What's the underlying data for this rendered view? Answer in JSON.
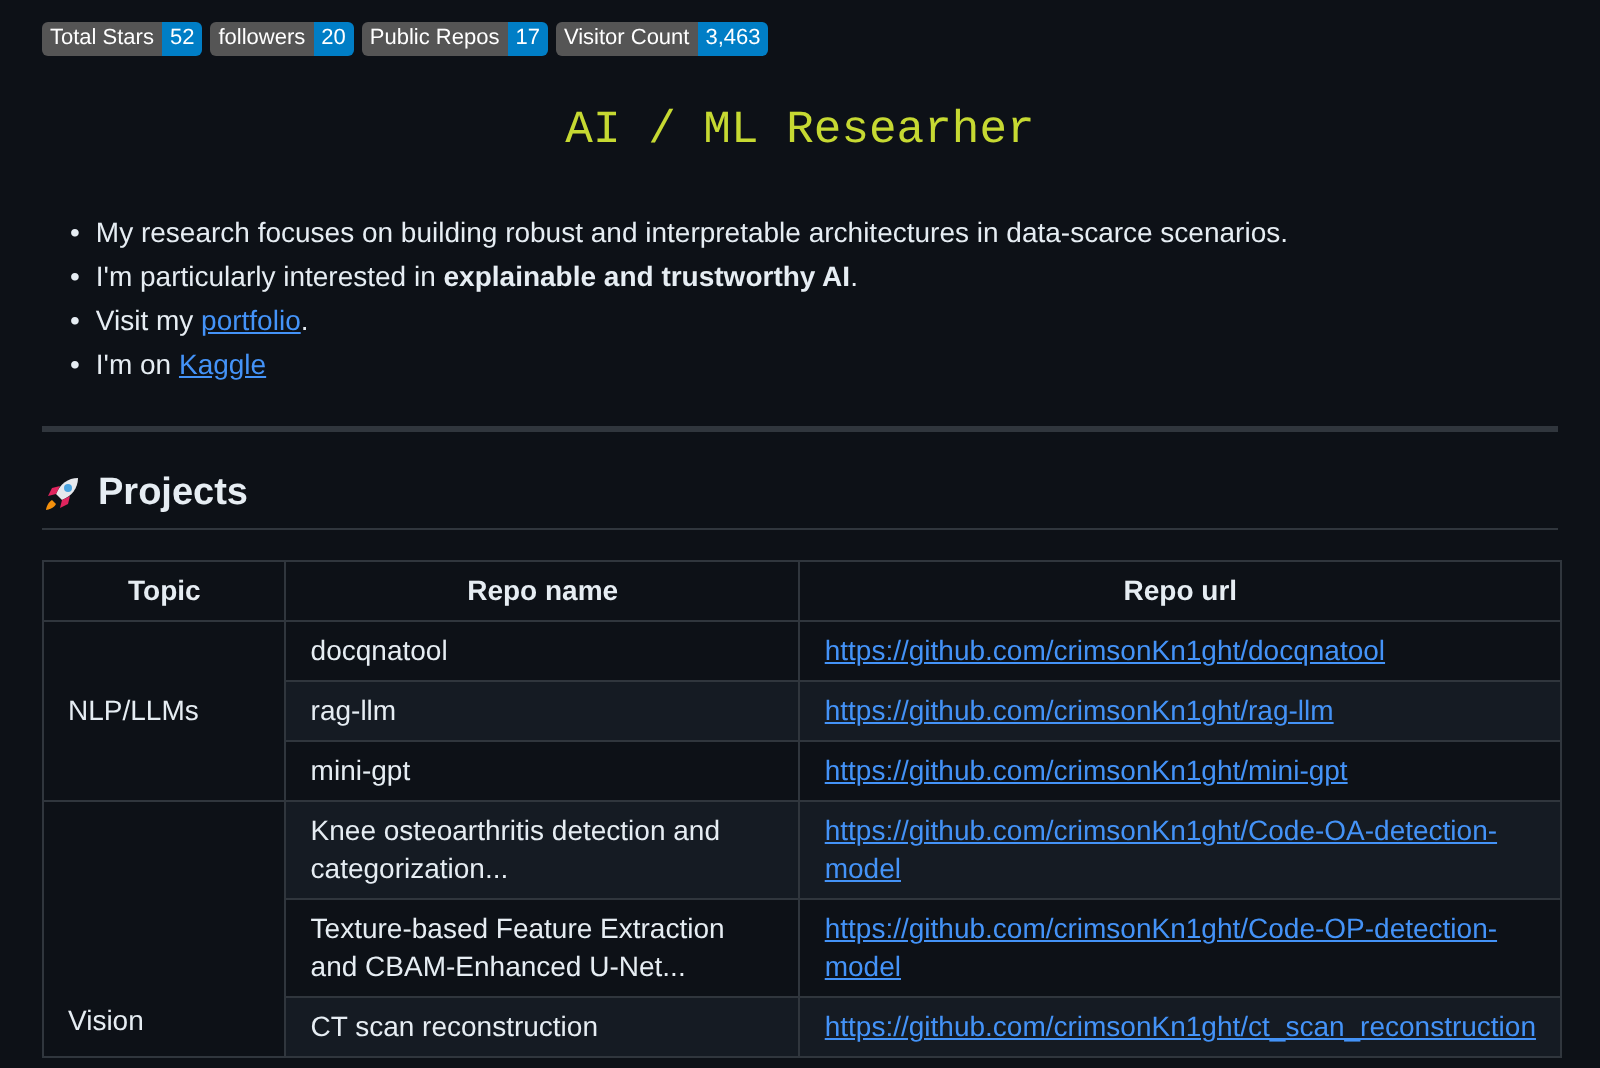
{
  "badges": [
    {
      "label": "Total Stars",
      "value": "52"
    },
    {
      "label": "followers",
      "value": "20"
    },
    {
      "label": "Public Repos",
      "value": "17"
    },
    {
      "label": "Visitor Count",
      "value": "3,463"
    }
  ],
  "title": "AI / ML Researher",
  "bullets": [
    {
      "marker": "•",
      "parts": [
        {
          "kind": "text",
          "text": "My research focuses on building robust and interpretable architectures in data-scarce scenarios."
        }
      ]
    },
    {
      "marker": "•",
      "parts": [
        {
          "kind": "text",
          "text": "I'm particularly interested in **explainable and trustworthy AI**."
        }
      ]
    },
    {
      "marker": "•",
      "parts": [
        {
          "kind": "text",
          "text": "Visit my "
        },
        {
          "kind": "link",
          "text": "portfolio"
        },
        {
          "kind": "text",
          "text": "."
        }
      ]
    },
    {
      "marker": "•",
      "parts": [
        {
          "kind": "text",
          "text": "I'm on "
        },
        {
          "kind": "link",
          "text": "Kaggle"
        }
      ]
    }
  ],
  "section": {
    "title": "Projects"
  },
  "table": {
    "columns": [
      "Topic",
      "Repo name",
      "Repo url"
    ],
    "groups": [
      {
        "topic": "NLP/LLMs",
        "rows": [
          {
            "name": "docqnatool",
            "url": "https://github.com/crimsonKn1ght/docqnatool"
          },
          {
            "name": "rag-llm",
            "url": "https://github.com/crimsonKn1ght/rag-llm"
          },
          {
            "name": "mini-gpt",
            "url": "https://github.com/crimsonKn1ght/mini-gpt"
          }
        ]
      },
      {
        "topic": "Vision",
        "rows": [
          {
            "name": "Knee osteoarthritis detection and categorization...",
            "url": "https://github.com/crimsonKn1ght/Code-OA-detection-model"
          },
          {
            "name": "Texture-based Feature Extraction and CBAM-Enhanced U-Net...",
            "url": "https://github.com/crimsonKn1ght/Code-OP-detection-model"
          },
          {
            "name": "CT scan reconstruction",
            "url": "https://github.com/crimsonKn1ght/ct_scan_reconstruction"
          }
        ]
      }
    ]
  }
}
